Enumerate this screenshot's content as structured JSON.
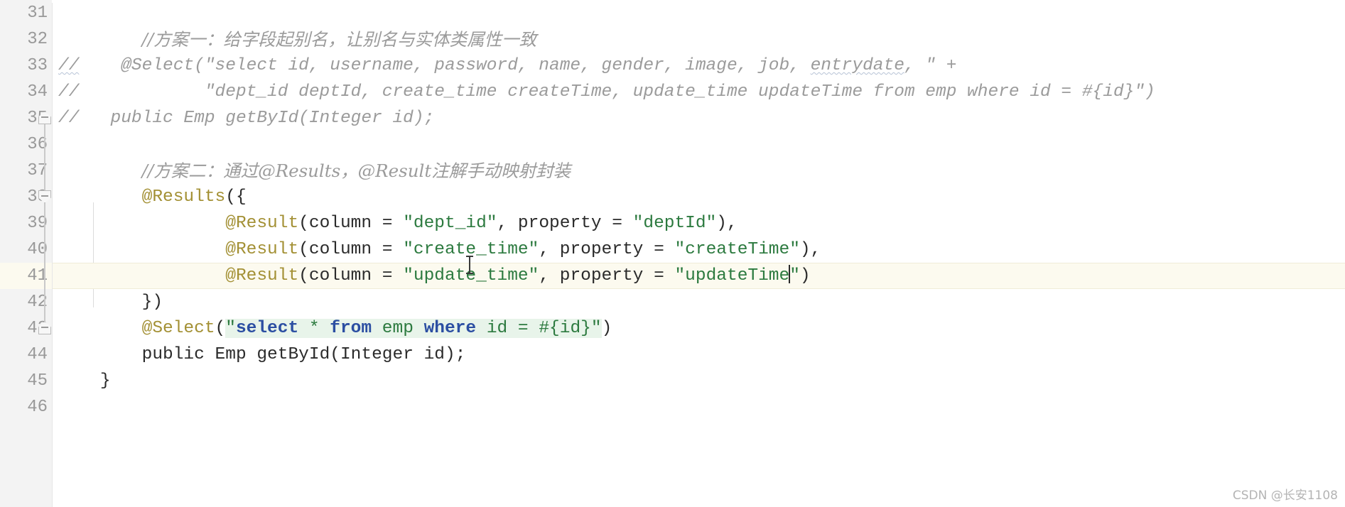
{
  "editor": {
    "language": "Java",
    "theme": "IntelliJ Light",
    "caret_line_number": "41",
    "colors": {
      "background": "#ffffff",
      "gutter_background": "#f3f3f3",
      "line_number": "#999999",
      "caret_line_background": "#fcfaef",
      "comment": "#9b9b9b",
      "annotation": "#a39034",
      "string": "#2c7a3f",
      "sql_keyword": "#2b4ea2",
      "injected_sql_background": "#e8f4ea",
      "default_text": "#2b2b2b"
    }
  },
  "gutter": {
    "line_numbers": [
      "31",
      "32",
      "33",
      "34",
      "35",
      "36",
      "37",
      "38",
      "39",
      "40",
      "41",
      "42",
      "43",
      "44",
      "45",
      "46"
    ],
    "fold_markers": [
      {
        "line": "35",
        "icon": "fold-arrow-up-icon"
      },
      {
        "line": "38",
        "icon": "fold-collapse-icon"
      },
      {
        "line": "43",
        "icon": "fold-arrow-up-icon"
      }
    ]
  },
  "code": {
    "lines": [
      {
        "n": "31",
        "segments": []
      },
      {
        "n": "32",
        "segments": [
          {
            "t": "        ",
            "c": "plain"
          },
          {
            "t": "//方案一：给字段起别名，让别名与实体类属性一致",
            "c": "cmt-cn"
          }
        ]
      },
      {
        "n": "33",
        "segments": [
          {
            "t": "//",
            "c": "cmt squig"
          },
          {
            "t": "    @Select(\"select id, username, password, name, gender, image, job, ",
            "c": "cmt"
          },
          {
            "t": "entrydate",
            "c": "cmt squig"
          },
          {
            "t": ", \" +",
            "c": "cmt"
          }
        ]
      },
      {
        "n": "34",
        "segments": [
          {
            "t": "//",
            "c": "cmt"
          },
          {
            "t": "            \"dept_id deptId, create_time createTime, update_time updateTime from emp where id = #{id}\")",
            "c": "cmt"
          }
        ]
      },
      {
        "n": "35",
        "segments": [
          {
            "t": "//",
            "c": "cmt"
          },
          {
            "t": "   public Emp getById(Integer id);",
            "c": "cmt"
          }
        ]
      },
      {
        "n": "36",
        "segments": []
      },
      {
        "n": "37",
        "segments": [
          {
            "t": "        ",
            "c": "plain"
          },
          {
            "t": "//方案二：通过@Results，@Result注解手动映射封装",
            "c": "cmt-cn"
          }
        ]
      },
      {
        "n": "38",
        "segments": [
          {
            "t": "        ",
            "c": "plain"
          },
          {
            "t": "@Results",
            "c": "ann"
          },
          {
            "t": "({",
            "c": "plain"
          }
        ]
      },
      {
        "n": "39",
        "segments": [
          {
            "t": "                ",
            "c": "plain"
          },
          {
            "t": "@Result",
            "c": "ann"
          },
          {
            "t": "(column = ",
            "c": "plain"
          },
          {
            "t": "\"dept_id\"",
            "c": "str"
          },
          {
            "t": ", property = ",
            "c": "plain"
          },
          {
            "t": "\"deptId\"",
            "c": "str"
          },
          {
            "t": "),",
            "c": "plain"
          }
        ]
      },
      {
        "n": "40",
        "segments": [
          {
            "t": "                ",
            "c": "plain"
          },
          {
            "t": "@Result",
            "c": "ann"
          },
          {
            "t": "(column = ",
            "c": "plain"
          },
          {
            "t": "\"create_time\"",
            "c": "str"
          },
          {
            "t": ", property = ",
            "c": "plain"
          },
          {
            "t": "\"createTime\"",
            "c": "str"
          },
          {
            "t": "),",
            "c": "plain"
          }
        ]
      },
      {
        "n": "41",
        "current": true,
        "segments": [
          {
            "t": "                ",
            "c": "plain"
          },
          {
            "t": "@Result",
            "c": "ann"
          },
          {
            "t": "(column = ",
            "c": "plain"
          },
          {
            "t": "\"update_time\"",
            "c": "str"
          },
          {
            "t": ", property = ",
            "c": "plain"
          },
          {
            "t": "\"updateTime",
            "c": "str"
          },
          {
            "t": "",
            "c": "caret"
          },
          {
            "t": "\"",
            "c": "str"
          },
          {
            "t": ")",
            "c": "plain"
          }
        ]
      },
      {
        "n": "42",
        "segments": [
          {
            "t": "        ",
            "c": "plain"
          },
          {
            "t": "})",
            "c": "plain"
          }
        ]
      },
      {
        "n": "43",
        "segments": [
          {
            "t": "        ",
            "c": "plain"
          },
          {
            "t": "@Select",
            "c": "ann"
          },
          {
            "t": "(",
            "c": "plain"
          },
          {
            "t": "\"",
            "c": "str sqlbg"
          },
          {
            "t": "select",
            "c": "sqlkw sqlbg"
          },
          {
            "t": " * ",
            "c": "str sqlbg"
          },
          {
            "t": "from",
            "c": "sqlkw sqlbg"
          },
          {
            "t": " emp ",
            "c": "str sqlbg"
          },
          {
            "t": "where",
            "c": "sqlkw sqlbg"
          },
          {
            "t": " id = #{id}",
            "c": "str sqlbg"
          },
          {
            "t": "\"",
            "c": "str sqlbg"
          },
          {
            "t": ")",
            "c": "plain"
          }
        ]
      },
      {
        "n": "44",
        "segments": [
          {
            "t": "        ",
            "c": "plain"
          },
          {
            "t": "public",
            "c": "kw"
          },
          {
            "t": " Emp getById(Integer id);",
            "c": "plain"
          }
        ]
      },
      {
        "n": "45",
        "segments": [
          {
            "t": "    ",
            "c": "plain"
          },
          {
            "t": "}",
            "c": "plain"
          }
        ]
      },
      {
        "n": "46",
        "segments": []
      }
    ]
  },
  "watermark": {
    "text": "CSDN @长安1108"
  }
}
